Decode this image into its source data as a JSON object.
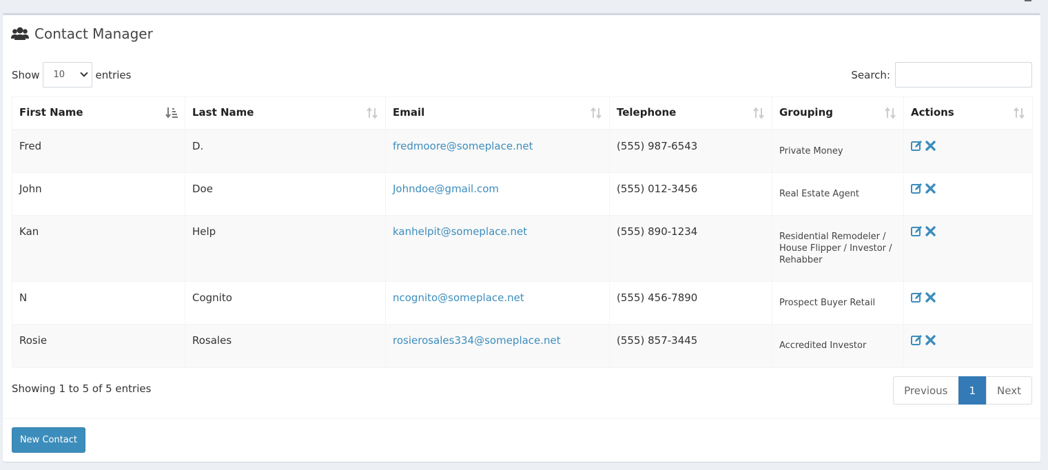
{
  "header": {
    "title": "Contact Manager",
    "icon": "users-icon"
  },
  "length_control": {
    "show_label": "Show",
    "value": "10",
    "entries_label": "entries"
  },
  "search": {
    "label": "Search:",
    "value": ""
  },
  "table": {
    "columns": [
      {
        "label": "First Name",
        "sort": "ascending"
      },
      {
        "label": "Last Name",
        "sort": "none"
      },
      {
        "label": "Email",
        "sort": "none"
      },
      {
        "label": "Telephone",
        "sort": "none"
      },
      {
        "label": "Grouping",
        "sort": "none"
      },
      {
        "label": "Actions",
        "sort": "none"
      }
    ],
    "rows": [
      {
        "first": "Fred",
        "last": "D.",
        "email": "fredmoore@someplace.net",
        "phone": "(555) 987-6543",
        "group": "Private Money"
      },
      {
        "first": "John",
        "last": "Doe",
        "email": "Johndoe@gmail.com",
        "phone": "(555) 012-3456",
        "group": "Real Estate Agent"
      },
      {
        "first": "Kan",
        "last": "Help",
        "email": "kanhelpit@someplace.net",
        "phone": "(555) 890-1234",
        "group": "Residential Remodeler / House Flipper / Investor / Rehabber"
      },
      {
        "first": "N",
        "last": "Cognito",
        "email": "ncognito@someplace.net",
        "phone": "(555) 456-7890",
        "group": "Prospect Buyer Retail"
      },
      {
        "first": "Rosie",
        "last": "Rosales",
        "email": "rosierosales334@someplace.net",
        "phone": "(555) 857-3445",
        "group": "Accredited Investor"
      }
    ]
  },
  "info": "Showing 1 to 5 of 5 entries",
  "pagination": {
    "previous": "Previous",
    "current": "1",
    "next": "Next"
  },
  "footer": {
    "new_contact": "New Contact"
  },
  "colors": {
    "accent": "#3c8dbc",
    "active_page": "#337ab7",
    "background": "#ecf0f5"
  }
}
